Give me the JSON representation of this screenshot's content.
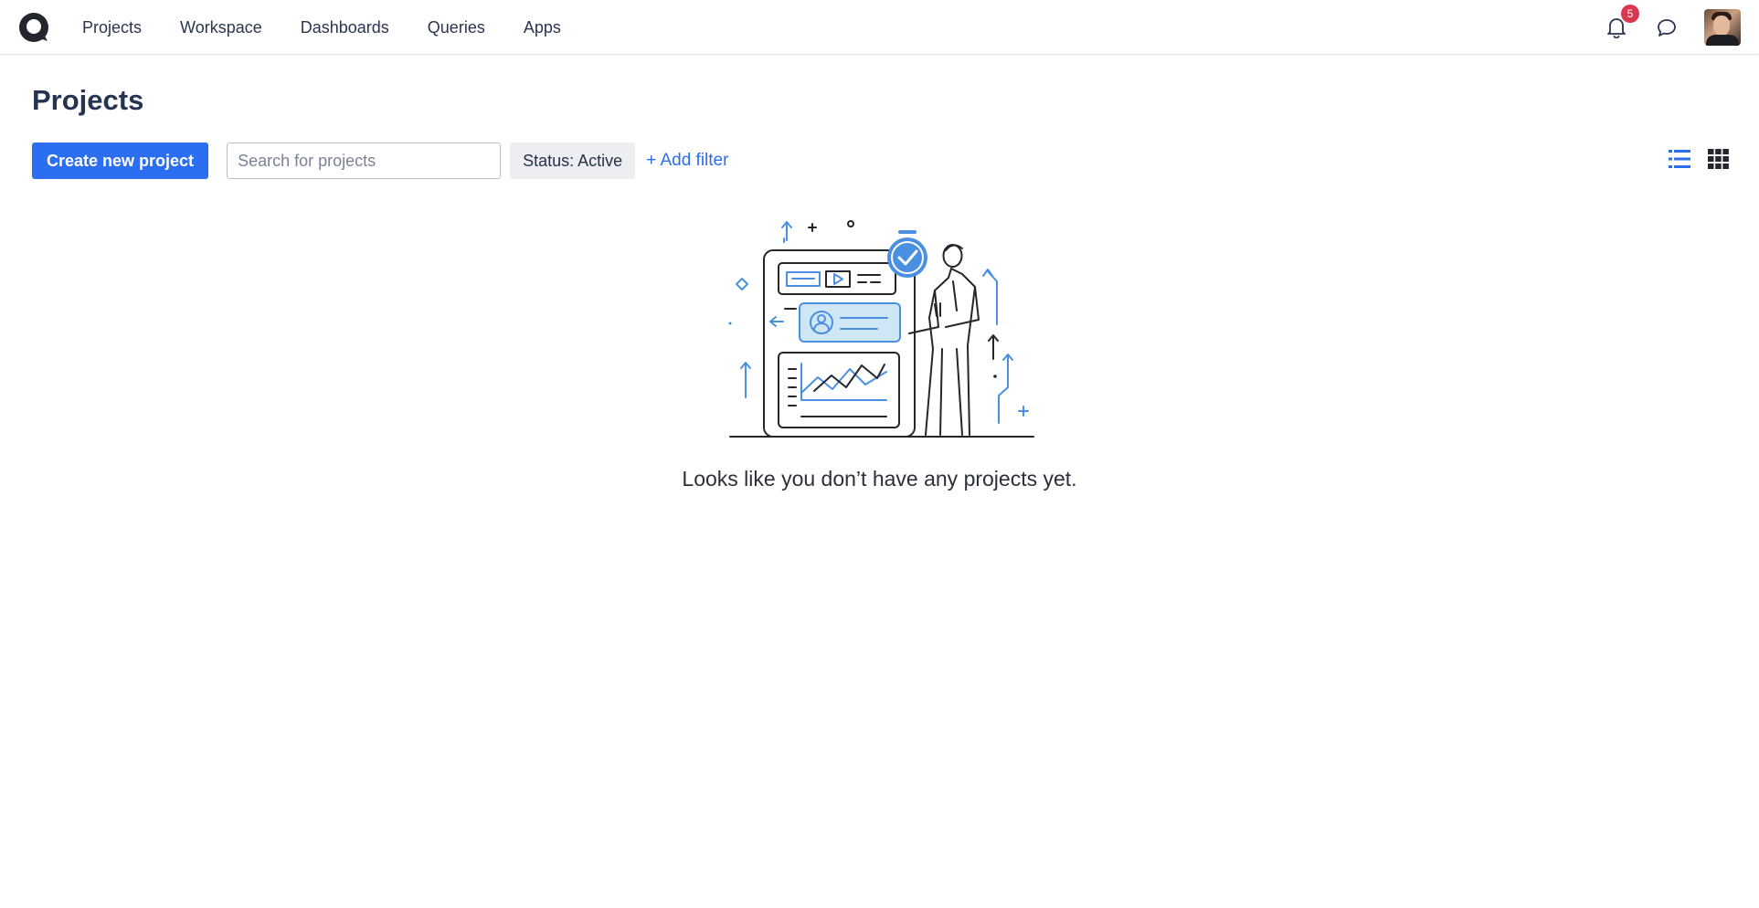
{
  "nav": {
    "items": [
      {
        "label": "Projects"
      },
      {
        "label": "Workspace"
      },
      {
        "label": "Dashboards"
      },
      {
        "label": "Queries"
      },
      {
        "label": "Apps"
      }
    ]
  },
  "header": {
    "notifications_count": "5",
    "icons": [
      "logo-icon",
      "bell-icon",
      "chat-icon"
    ]
  },
  "page": {
    "title": "Projects"
  },
  "toolbar": {
    "create_label": "Create new project",
    "search_placeholder": "Search for projects",
    "search_value": "",
    "status_filter": "Status: Active",
    "add_filter_label": "+ Add filter"
  },
  "empty_state": {
    "message": "Looks like you don’t have any projects yet."
  },
  "colors": {
    "accent": "#2b6ff0",
    "badge": "#d9364f",
    "title": "#243452"
  }
}
